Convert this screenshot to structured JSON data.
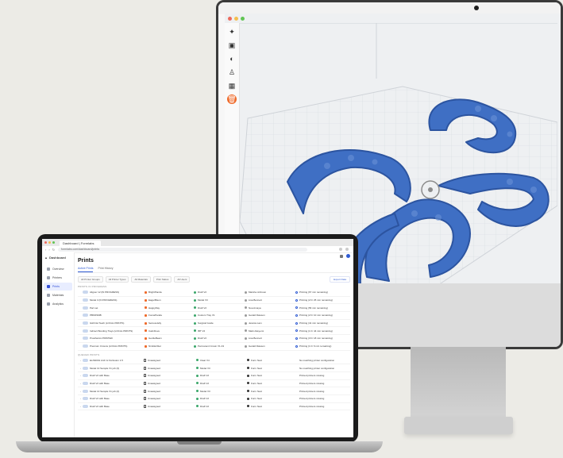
{
  "app": {
    "brand": "Dashboard",
    "tab_title": "Dashboard | Formlabs",
    "url": "formlabs.com/dashboard/prints",
    "page_title": "Prints"
  },
  "tabs": [
    {
      "label": "Active Prints"
    },
    {
      "label": "Print History"
    }
  ],
  "filters": [
    "All Printer Groups",
    "All Printer Types",
    "All Materials",
    "Print Status",
    "All Users"
  ],
  "export_label": "Export Data",
  "sidebar": {
    "items": [
      {
        "label": "Overview"
      },
      {
        "label": "Printers"
      },
      {
        "label": "Prints"
      },
      {
        "label": "Materials"
      },
      {
        "label": "Analytics"
      },
      {
        "label": "Members"
      }
    ]
  },
  "sections": {
    "active": "PRINTS IN PROGRESS",
    "queue": "QUEUED PRINTS"
  },
  "active_rows": [
    {
      "name": "Aligner 12 (IN PROGRESS)",
      "printer": "BrightPanda",
      "material": "Draft V2",
      "user": "Marsha Johnson",
      "status": "Printing (67 min remaining)"
    },
    {
      "name": "Model 3 (IN PROGRESS)",
      "printer": "EagerBison",
      "material": "Model V3",
      "user": "Lisa Bennett",
      "status": "Printing (2 hr 25 min remaining)"
    },
    {
      "name": "Part set",
      "printer": "HappyRay",
      "material": "Draft V2",
      "user": "Noa Amaya",
      "status": "Printing (56 min remaining)"
    },
    {
      "name": "PBKDSMB",
      "printer": "FocusPanda",
      "material": "Custom Tray V1",
      "user": "Gerald Dawson",
      "status": "Printing (2 hr 10 min remaining)"
    },
    {
      "name": "Gilchrist Teeth (LOCAL PRINTS)",
      "printer": "SeriousJelly",
      "material": "Surgical Guide",
      "user": "Jessica Lam",
      "status": "Printing (41 min remaining)"
    },
    {
      "name": "Indirect Bonding Trays (LOCAL PRINTS)",
      "printer": "CalmDove",
      "material": "IBT V2",
      "user": "Mark Adeyemi",
      "status": "Printing (1 hr 44 min remaining)"
    },
    {
      "name": "Prosthetics PRINTED",
      "printer": "GentleBeam",
      "material": "Draft V2",
      "user": "Lisa Bennett",
      "status": "Printing (3 hr 18 min remaining)"
    },
    {
      "name": "Premium Crowns (LOCAL PRINTS)",
      "printer": "NimbleOtter",
      "material": "Permanent Crown V1 A3",
      "user": "Gerald Dawson",
      "status": "Printing (1 hr 6 min remaining)"
    }
  ],
  "queue_rows": [
    {
      "name": "ELIS0001 Arch & Occlusion 1.5",
      "file": "Unassigned",
      "material": "Clear V4",
      "printer": "Form Next",
      "note": "No matching printer configuration"
    },
    {
      "name": "Model 13 Sample V1 job (3)",
      "file": "Unassigned",
      "material": "Model V3",
      "printer": "Form Next",
      "note": "No matching printer configuration"
    },
    {
      "name": "Draft V2 with Base",
      "file": "Unassigned",
      "material": "Draft V2",
      "printer": "Form Next",
      "note": "Printed printers missing"
    },
    {
      "name": "Draft V2 with Base",
      "file": "Unassigned",
      "material": "Draft V2",
      "printer": "Form Next",
      "note": "Printed printers missing"
    },
    {
      "name": "Model 13 Sample V1 job (2)",
      "file": "Unassigned",
      "material": "Model V3",
      "printer": "Form Next",
      "note": "Printed printers missing"
    },
    {
      "name": "Draft V2 with Base",
      "file": "Unassigned",
      "material": "Draft V2",
      "printer": "Form Next",
      "note": "Printed printers missing"
    },
    {
      "name": "Draft V2 with Base",
      "file": "Unassigned",
      "material": "Draft V2",
      "printer": "Form Next",
      "note": "Printed printers missing"
    }
  ],
  "colors": {
    "accent": "#2f5bd3",
    "aligner": "#3f6fc4",
    "orange": "#ef6a2a"
  },
  "icons": {
    "tools": [
      "magic-wand-icon",
      "layout-icon",
      "orient-icon",
      "support-icon",
      "grid-icon",
      "delete-icon"
    ]
  }
}
